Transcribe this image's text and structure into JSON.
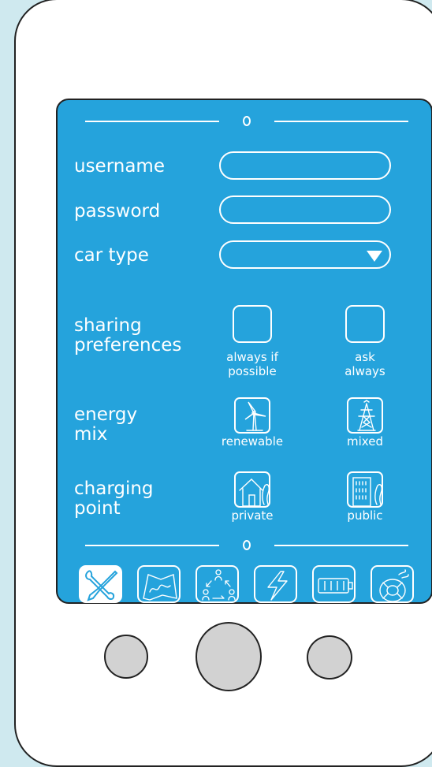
{
  "colors": {
    "screen": "#25a3dc",
    "page_bg": "#cfe9ef",
    "hardware_button": "#d2d2d2"
  },
  "form": {
    "username": {
      "label": "username",
      "value": ""
    },
    "password": {
      "label": "password",
      "value": ""
    },
    "car_type": {
      "label": "car type",
      "value": ""
    },
    "sharing": {
      "label_line1": "sharing",
      "label_line2": "preferences",
      "options": [
        {
          "line1": "always if",
          "line2": "possible",
          "checked": false
        },
        {
          "line1": "ask",
          "line2": "always",
          "checked": false
        }
      ]
    },
    "energy": {
      "label_line1": "energy",
      "label_line2": "mix",
      "options": [
        {
          "label": "renewable",
          "icon": "wind-turbine-icon"
        },
        {
          "label": "mixed",
          "icon": "power-tower-icon"
        }
      ]
    },
    "charging": {
      "label_line1": "charging",
      "label_line2": "point",
      "options": [
        {
          "label": "private",
          "icon": "house-icon"
        },
        {
          "label": "public",
          "icon": "building-icon"
        }
      ]
    }
  },
  "tabs": [
    {
      "icon": "tools-icon",
      "active": true
    },
    {
      "icon": "map-icon",
      "active": false
    },
    {
      "icon": "community-icon",
      "active": false
    },
    {
      "icon": "lightning-icon",
      "active": false
    },
    {
      "icon": "battery-icon",
      "active": false
    },
    {
      "icon": "lifebuoy-icon",
      "active": false
    }
  ]
}
